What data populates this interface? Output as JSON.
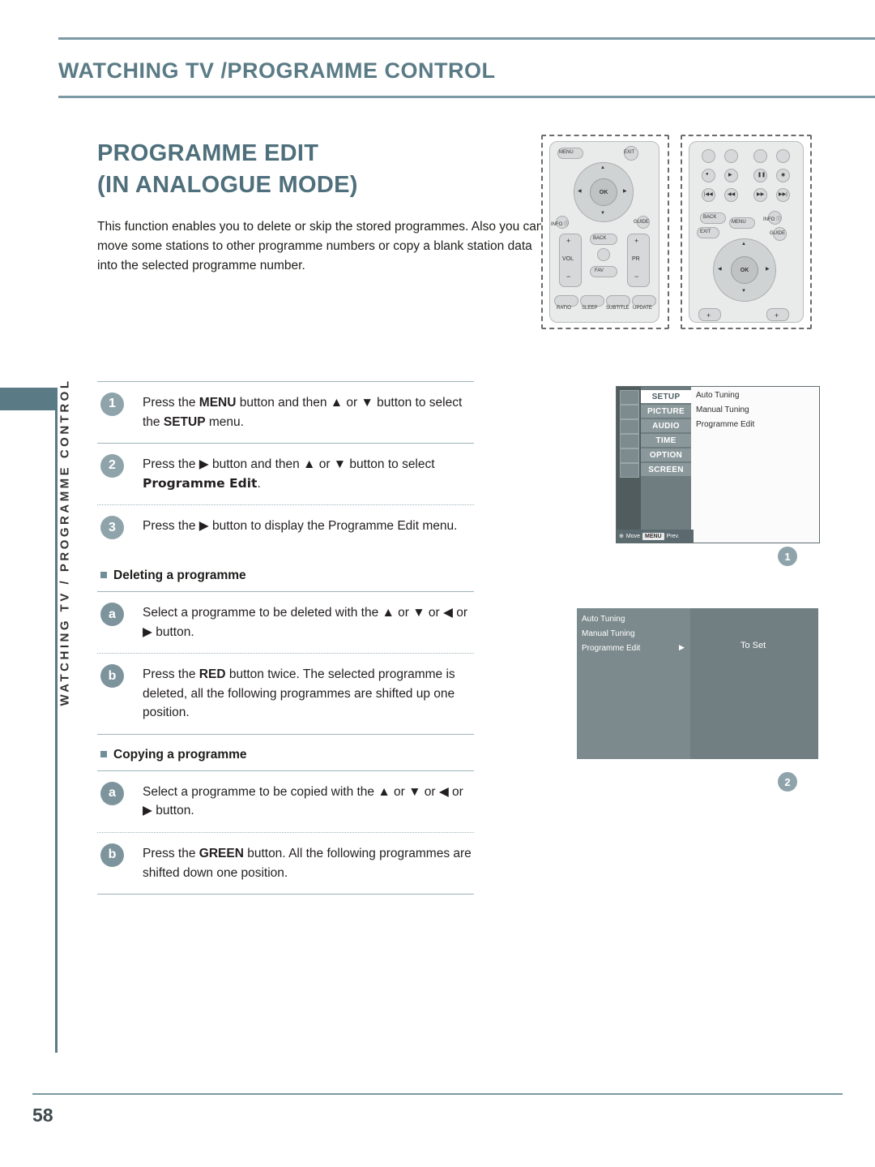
{
  "header": {
    "title": "WATCHING TV /PROGRAMME CONTROL",
    "side_tab": "WATCHING TV / PROGRAMME CONTROL"
  },
  "main": {
    "title_line1": "PROGRAMME EDIT",
    "title_line2": "(IN ANALOGUE MODE)",
    "intro": "This function enables you to delete or skip the stored programmes. Also you can move some stations to other programme numbers or copy a blank station data into the selected programme number."
  },
  "steps": [
    {
      "badge": "1",
      "text_before": "Press the ",
      "bold1": "MENU",
      "text_mid": " button and then ▲ or ▼ button to select the ",
      "bold2": "SETUP",
      "text_after": " menu."
    },
    {
      "badge": "2",
      "text_before": "Press the ▶ button and then ▲ or ▼ button to select ",
      "bold1": "Programme Edit",
      "text_after": "."
    },
    {
      "badge": "3",
      "text_before": "Press the ▶ button to display the Programme Edit menu."
    }
  ],
  "sections": [
    {
      "heading": "Deleting a programme",
      "items": [
        {
          "badge": "a",
          "text": "Select a programme to be deleted with the ▲ or ▼ or ◀ or ▶ button."
        },
        {
          "badge": "b",
          "text_before": "Press the ",
          "bold1": "RED",
          "text_after": " button twice. The selected programme is deleted, all the following programmes are shifted up one position."
        }
      ]
    },
    {
      "heading": "Copying a programme",
      "items": [
        {
          "badge": "a",
          "text": "Select a programme to be copied with the ▲ or ▼ or ◀ or ▶ button."
        },
        {
          "badge": "b",
          "text_before": "Press the ",
          "bold1": "GREEN",
          "text_after": " button. All the following programmes are shifted down one position."
        }
      ]
    }
  ],
  "remote1": {
    "labels": [
      "MENU",
      "EXIT",
      "INFO ⓘ",
      "GUIDE",
      "OK",
      "VOL",
      "PR",
      "BACK",
      "FAV",
      "RATIO",
      "SLEEP",
      "SUBTITLE",
      "UPDATE"
    ]
  },
  "remote2": {
    "labels": [
      "BACK",
      "MENU",
      "INFO ⓘ",
      "EXIT",
      "GUIDE",
      "OK"
    ]
  },
  "osd1": {
    "tabs": [
      "SETUP",
      "PICTURE",
      "AUDIO",
      "TIME",
      "OPTION",
      "SCREEN"
    ],
    "selected_tab": "SETUP",
    "items": [
      "Auto Tuning",
      "Manual Tuning",
      "Programme Edit"
    ],
    "footer": {
      "move_label": "Move",
      "menu_btn": "MENU",
      "prev_label": "Prev."
    },
    "callout": "1"
  },
  "osd2": {
    "items": [
      "Auto Tuning",
      "Manual Tuning",
      "Programme Edit"
    ],
    "right_label": "To Set",
    "callout": "2"
  },
  "footer": {
    "page_number": "58"
  }
}
